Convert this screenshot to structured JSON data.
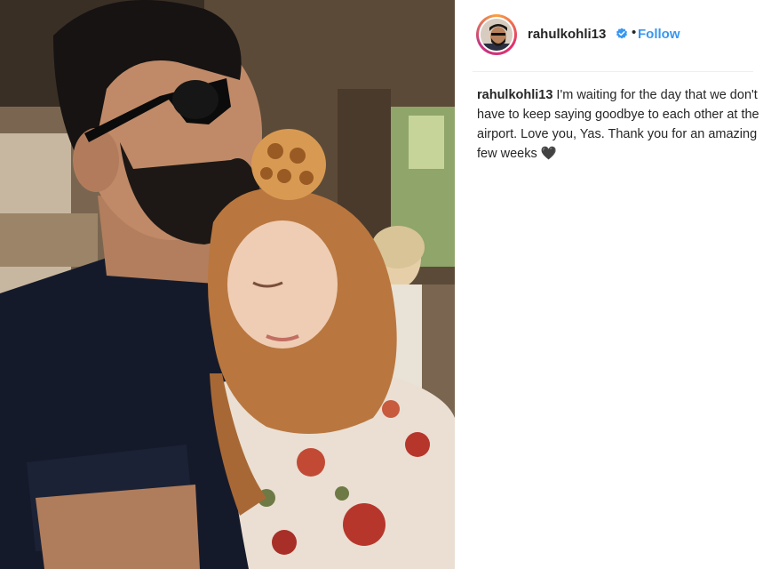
{
  "post": {
    "username": "rahulkohli13",
    "follow_label": "Follow",
    "separator": "•",
    "caption_username": "rahulkohli13",
    "caption_text": "I'm waiting for the day that we don't have to keep saying goodbye to each other at the airport. Love you, Yas. Thank you for an amazing few weeks",
    "caption_emoji": "🖤"
  },
  "icons": {
    "verified": "verified-badge-icon",
    "avatar": "profile-avatar",
    "photo": "post-photo"
  },
  "colors": {
    "follow": "#3897f0",
    "verified": "#3897f0",
    "text": "#262626",
    "divider": "#efefef"
  }
}
